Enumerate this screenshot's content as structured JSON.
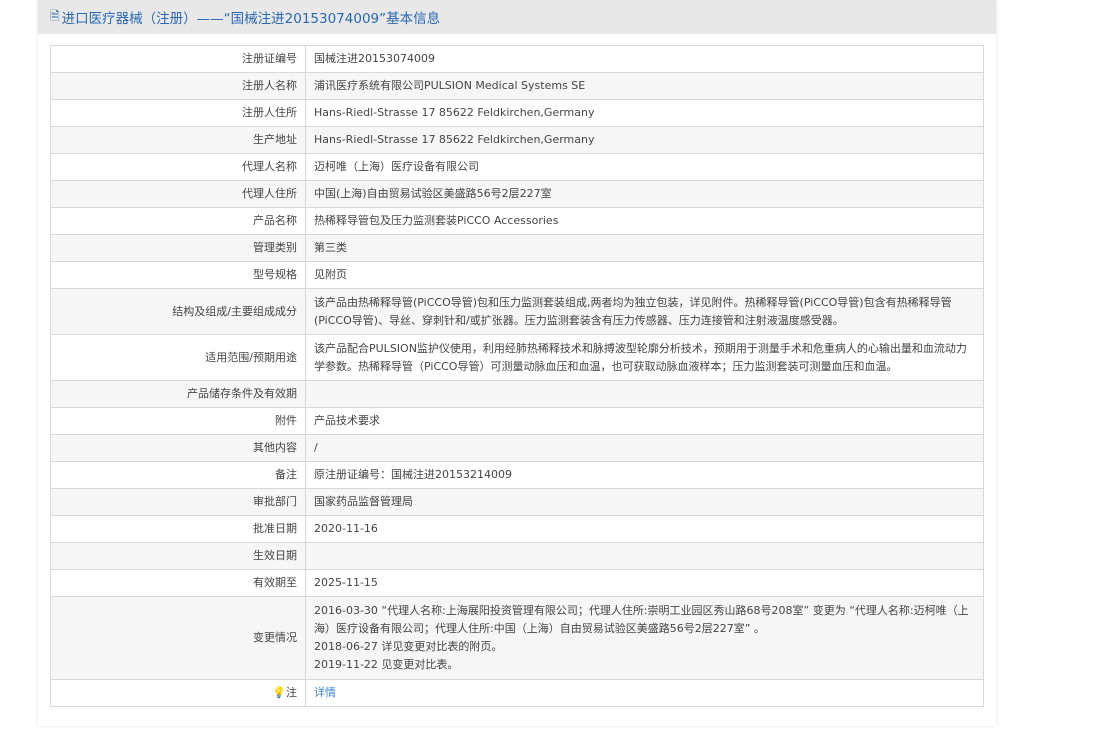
{
  "header": {
    "icon": "document-icon",
    "title": "进口医疗器械（注册）——“国械注进20153074009”基本信息"
  },
  "rows": [
    {
      "label": "注册证编号",
      "value": "国械注进20153074009"
    },
    {
      "label": "注册人名称",
      "value": "浦讯医疗系统有限公司PULSION Medical Systems SE"
    },
    {
      "label": "注册人住所",
      "value": "Hans-Riedl-Strasse 17 85622 Feldkirchen,Germany"
    },
    {
      "label": "生产地址",
      "value": "Hans-Riedl-Strasse 17 85622 Feldkirchen,Germany"
    },
    {
      "label": "代理人名称",
      "value": "迈柯唯（上海）医疗设备有限公司"
    },
    {
      "label": "代理人住所",
      "value": "中国(上海)自由贸易试验区美盛路56号2层227室"
    },
    {
      "label": "产品名称",
      "value": "热稀释导管包及压力监测套装PiCCO Accessories"
    },
    {
      "label": "管理类别",
      "value": "第三类"
    },
    {
      "label": "型号规格",
      "value": "见附页"
    },
    {
      "label": "结构及组成/主要组成成分",
      "value": "该产品由热稀释导管(PiCCO导管)包和压力监测套装组成,两者均为独立包装，详见附件。热稀释导管(PiCCO导管)包含有热稀释导管(PiCCO导管)、导丝、穿刺针和/或扩张器。压力监测套装含有压力传感器、压力连接管和注射液温度感受器。"
    },
    {
      "label": "适用范围/预期用途",
      "value": "该产品配合PULSION监护仪使用，利用经肺热稀释技术和脉搏波型轮廓分析技术，预期用于测量手术和危重病人的心输出量和血流动力学参数。热稀释导管（PiCCO导管）可测量动脉血压和血温，也可获取动脉血液样本；压力监测套装可测量血压和血温。"
    },
    {
      "label": "产品储存条件及有效期",
      "value": ""
    },
    {
      "label": "附件",
      "value": "产品技术要求"
    },
    {
      "label": "其他内容",
      "value": "/"
    },
    {
      "label": "备注",
      "value": "原注册证编号：国械注进20153214009"
    },
    {
      "label": "审批部门",
      "value": "国家药品监督管理局"
    },
    {
      "label": "批准日期",
      "value": "2020-11-16"
    },
    {
      "label": "生效日期",
      "value": ""
    },
    {
      "label": "有效期至",
      "value": "2025-11-15"
    }
  ],
  "changes": {
    "label": "变更情况",
    "lines": [
      "2016-03-30 “代理人名称:上海展阳投资管理有限公司；代理人住所:崇明工业园区秀山路68号208室” 变更为 “代理人名称:迈柯唯（上海）医疗设备有限公司；代理人住所:中国（上海）自由贸易试验区美盛路56号2层227室” 。",
      "2018-06-27 详见变更对比表的附页。",
      "2019-11-22 见变更对比表。"
    ]
  },
  "note": {
    "icon": "lightbulb-icon",
    "label": "注",
    "link": "详情"
  }
}
